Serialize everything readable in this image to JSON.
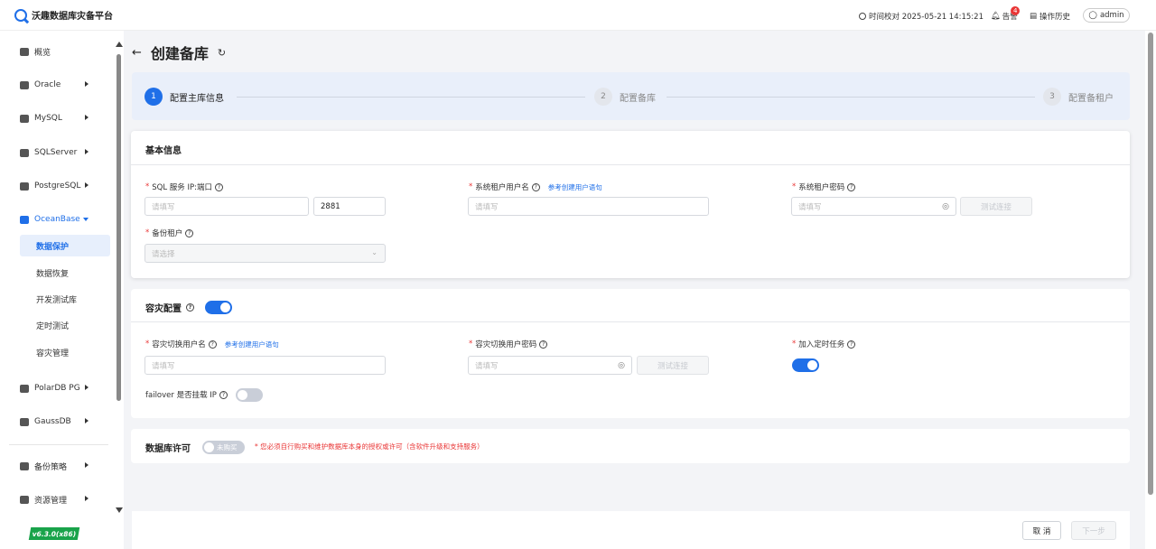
{
  "app": {
    "name": "沃趣数据库灾备平台"
  },
  "topbar": {
    "time": "时间校对 2025-05-21 14:15:21",
    "alert_label": "告警",
    "alert_count": "4",
    "history_label": "操作历史",
    "user": "admin"
  },
  "sidebar": {
    "items": [
      {
        "label": "概览"
      },
      {
        "label": "Oracle"
      },
      {
        "label": "MySQL"
      },
      {
        "label": "SQLServer"
      },
      {
        "label": "PostgreSQL"
      },
      {
        "label": "OceanBase"
      },
      {
        "label": "PolarDB PG"
      },
      {
        "label": "GaussDB"
      },
      {
        "label": "备份策略"
      },
      {
        "label": "资源管理"
      }
    ],
    "sub_items": [
      {
        "label": "数据保护"
      },
      {
        "label": "数据恢复"
      },
      {
        "label": "开发测试库"
      },
      {
        "label": "定时测试"
      },
      {
        "label": "容灾管理"
      }
    ],
    "version": "v6.3.0(x86)"
  },
  "page": {
    "title": "创建备库"
  },
  "steps": [
    {
      "num": "1",
      "label": "配置主库信息"
    },
    {
      "num": "2",
      "label": "配置备库"
    },
    {
      "num": "3",
      "label": "配置备租户"
    }
  ],
  "basic": {
    "title": "基本信息",
    "ip_label": "SQL 服务 IP:端口",
    "ip_placeholder": "请填写",
    "port_value": "2881",
    "sys_user_label": "系统租户用户名",
    "sys_user_link": "参考创建用户语句",
    "sys_user_placeholder": "请填写",
    "sys_pwd_label": "系统租户密码",
    "sys_pwd_placeholder": "请填写",
    "test_conn": "测试连接",
    "backup_tenant_label": "备份租户",
    "backup_tenant_placeholder": "请选择"
  },
  "dr": {
    "title": "容灾配置",
    "enabled": true,
    "switch_user_label": "容灾切换用户名",
    "switch_user_link": "参考创建用户语句",
    "switch_user_placeholder": "请填写",
    "switch_pwd_label": "容灾切换用户密码",
    "switch_pwd_placeholder": "请填写",
    "test_conn": "测试连接",
    "schedule_label": "加入定时任务",
    "schedule_enabled": true,
    "failover_label": "failover 是否挂载 IP",
    "failover_enabled": false
  },
  "license": {
    "title": "数据库许可",
    "toggle_text": "未购买",
    "warning": "* 您必须自行购买和维护数据库本身的授权或许可（含软件升级和支持服务）"
  },
  "footer": {
    "cancel": "取 消",
    "next": "下一步"
  }
}
